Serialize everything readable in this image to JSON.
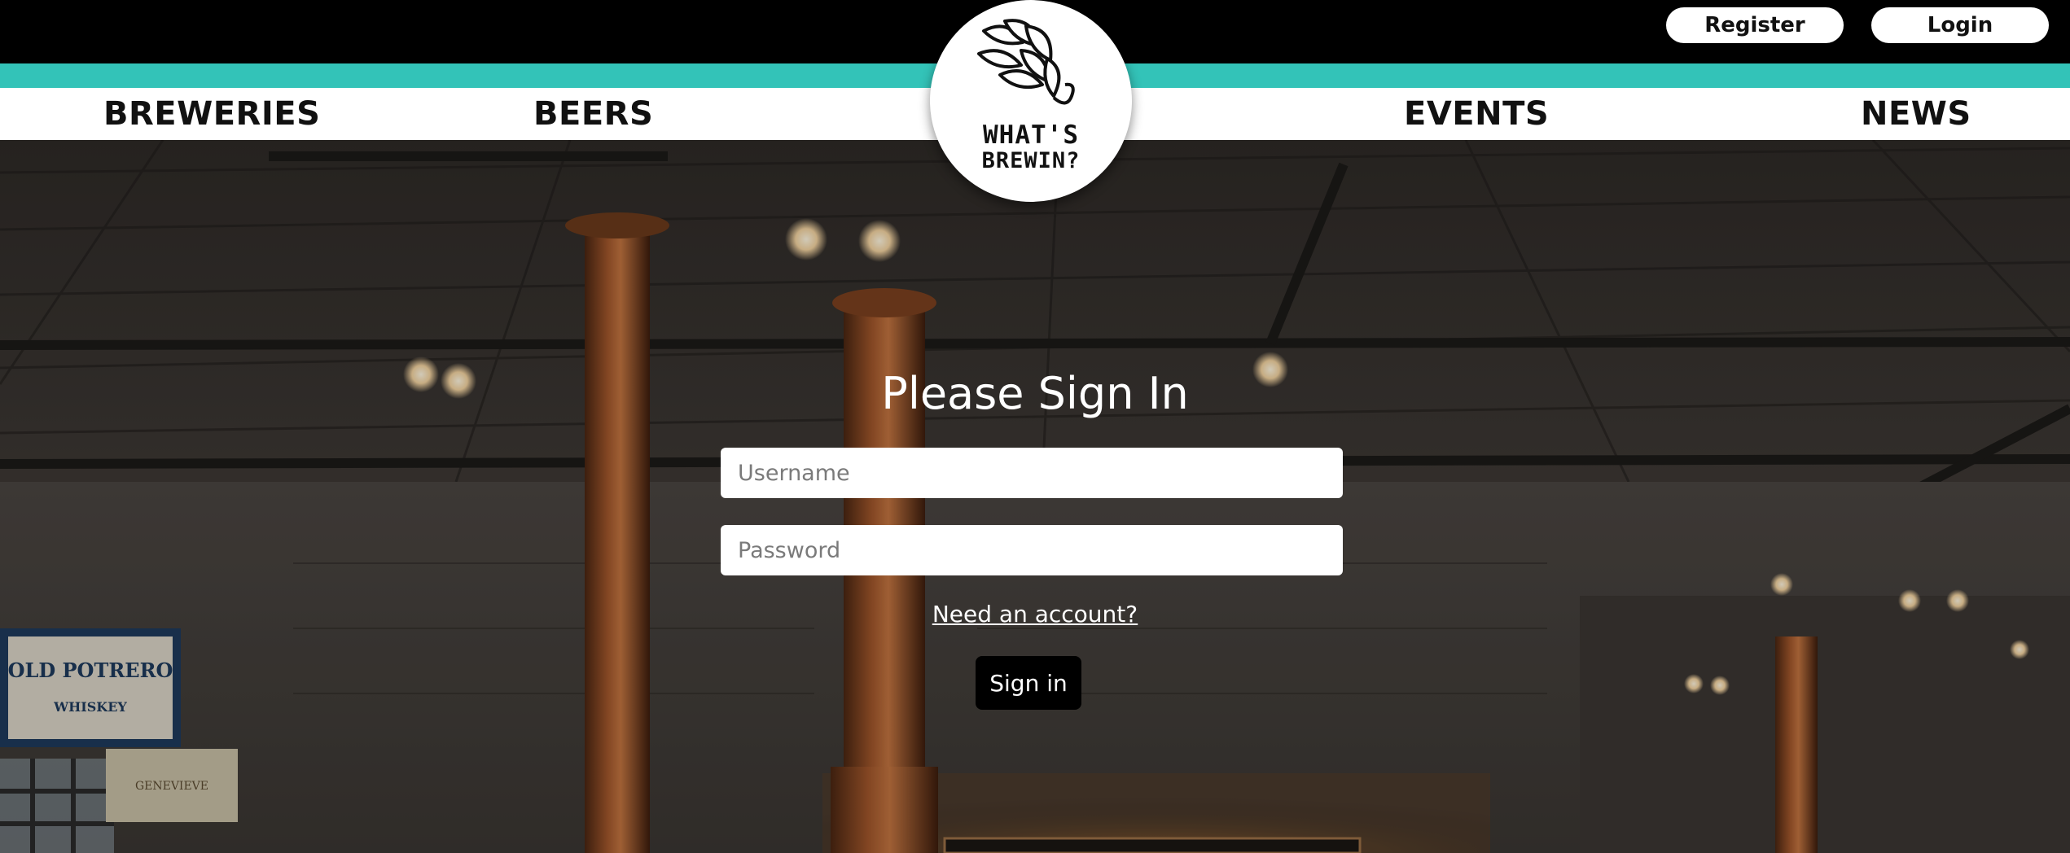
{
  "header": {
    "register_label": "Register",
    "login_label": "Login",
    "logo_line1": "WHAT'S",
    "logo_line2": "BREWIN?"
  },
  "nav": {
    "breweries": "BREWERIES",
    "beers": "BEERS",
    "events": "EVENTS",
    "news": "NEWS"
  },
  "signin": {
    "title": "Please Sign In",
    "username_placeholder": "Username",
    "password_placeholder": "Password",
    "need_account": "Need an account?",
    "button": "Sign in"
  },
  "background": {
    "banner1_line1": "OLD POTRERO",
    "banner1_line2": "WHISKEY",
    "banner2_text": "GENEVIEVE"
  },
  "colors": {
    "accent_teal": "#33c3b8",
    "top_bar": "#000000",
    "nav_bg": "#ffffff"
  }
}
